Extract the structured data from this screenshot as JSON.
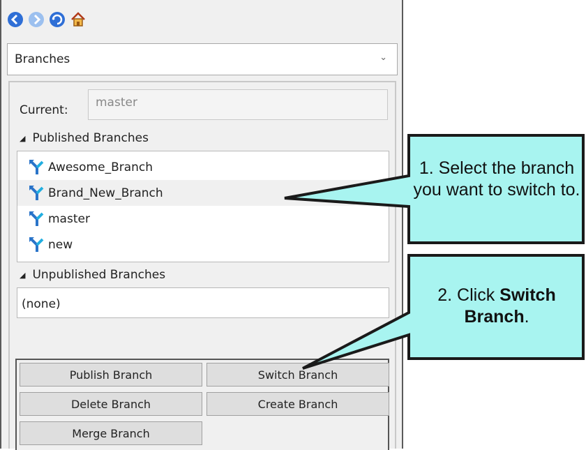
{
  "dropdown": {
    "selected": "Branches"
  },
  "current": {
    "label": "Current:",
    "value": "master"
  },
  "published": {
    "header": "Published Branches",
    "items": [
      "Awesome_Branch",
      "Brand_New_Branch",
      "master",
      "new"
    ]
  },
  "unpublished": {
    "header": "Unpublished Branches",
    "items": [
      "(none)"
    ]
  },
  "buttons": {
    "publish": "Publish Branch",
    "switch": "Switch Branch",
    "delete": "Delete Branch",
    "create": "Create Branch",
    "merge": "Merge Branch"
  },
  "callouts": {
    "step1": "1. Select the branch you want to switch to.",
    "step2_prefix": "2. Click ",
    "step2_bold": "Switch Branch",
    "step2_suffix": "."
  },
  "icons": {
    "nav": [
      "back-icon",
      "forward-icon",
      "refresh-icon",
      "home-icon"
    ],
    "branch": "branch-icon"
  },
  "colors": {
    "callout_fill": "#a8f4f0",
    "callout_border": "#1a1a1a",
    "nav_blue": "#2f6fd6"
  }
}
